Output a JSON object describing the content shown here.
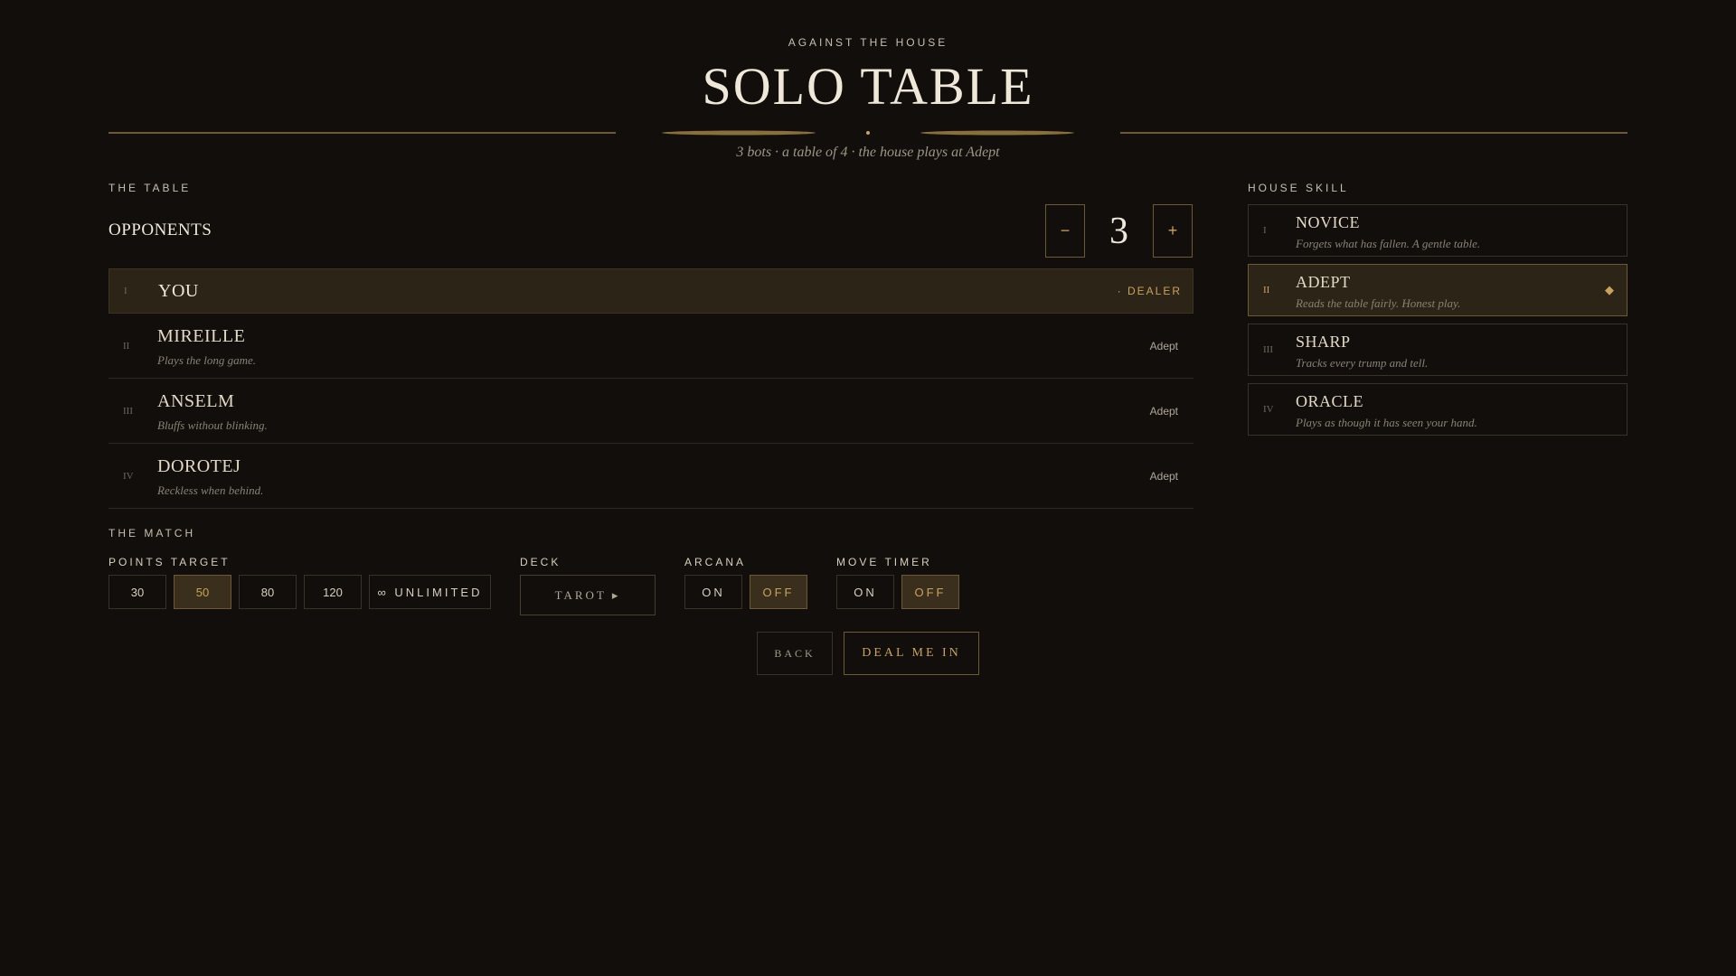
{
  "header": {
    "eyebrow": "AGAINST THE HOUSE",
    "title": "SOLO TABLE",
    "subtitle": "3 bots · a table of 4 · the house plays at Adept"
  },
  "table": {
    "section_label": "THE TABLE",
    "opponents_label": "OPPONENTS",
    "opponents_count": "3",
    "minus_label": "−",
    "plus_label": "+",
    "players": [
      {
        "num": "I",
        "name": "YOU",
        "desc": "",
        "badge": "· DEALER"
      },
      {
        "num": "II",
        "name": "MIREILLE",
        "desc": "Plays the long game.",
        "level": "Adept"
      },
      {
        "num": "III",
        "name": "ANSELM",
        "desc": "Bluffs without blinking.",
        "level": "Adept"
      },
      {
        "num": "IV",
        "name": "DOROTEJ",
        "desc": "Reckless when behind.",
        "level": "Adept"
      }
    ]
  },
  "house_skill": {
    "section_label": "HOUSE SKILL",
    "selected": "ADEPT",
    "levels": [
      {
        "num": "I",
        "name": "NOVICE",
        "desc": "Forgets what has fallen. A gentle table."
      },
      {
        "num": "II",
        "name": "ADEPT",
        "desc": "Reads the table fairly. Honest play.",
        "marker": "◆"
      },
      {
        "num": "III",
        "name": "SHARP",
        "desc": "Tracks every trump and tell."
      },
      {
        "num": "IV",
        "name": "ORACLE",
        "desc": "Plays as though it has seen your hand."
      }
    ]
  },
  "match": {
    "section_label": "THE MATCH",
    "points_target": {
      "label": "POINTS TARGET",
      "options": [
        "30",
        "50",
        "80",
        "120",
        "∞ UNLIMITED"
      ],
      "selected": "50"
    },
    "deck": {
      "label": "DECK",
      "value": "TAROT ▸"
    },
    "arcana": {
      "label": "ARCANA",
      "on": "ON",
      "off": "OFF",
      "selected": "OFF"
    },
    "move_timer": {
      "label": "MOVE TIMER",
      "on": "ON",
      "off": "OFF",
      "selected": "OFF"
    }
  },
  "actions": {
    "back": "BACK",
    "deal": "DEAL ME IN"
  },
  "colors": {
    "background": "#110e0c",
    "gold": "#c9a35a",
    "selected_fill": "#2d2418"
  }
}
